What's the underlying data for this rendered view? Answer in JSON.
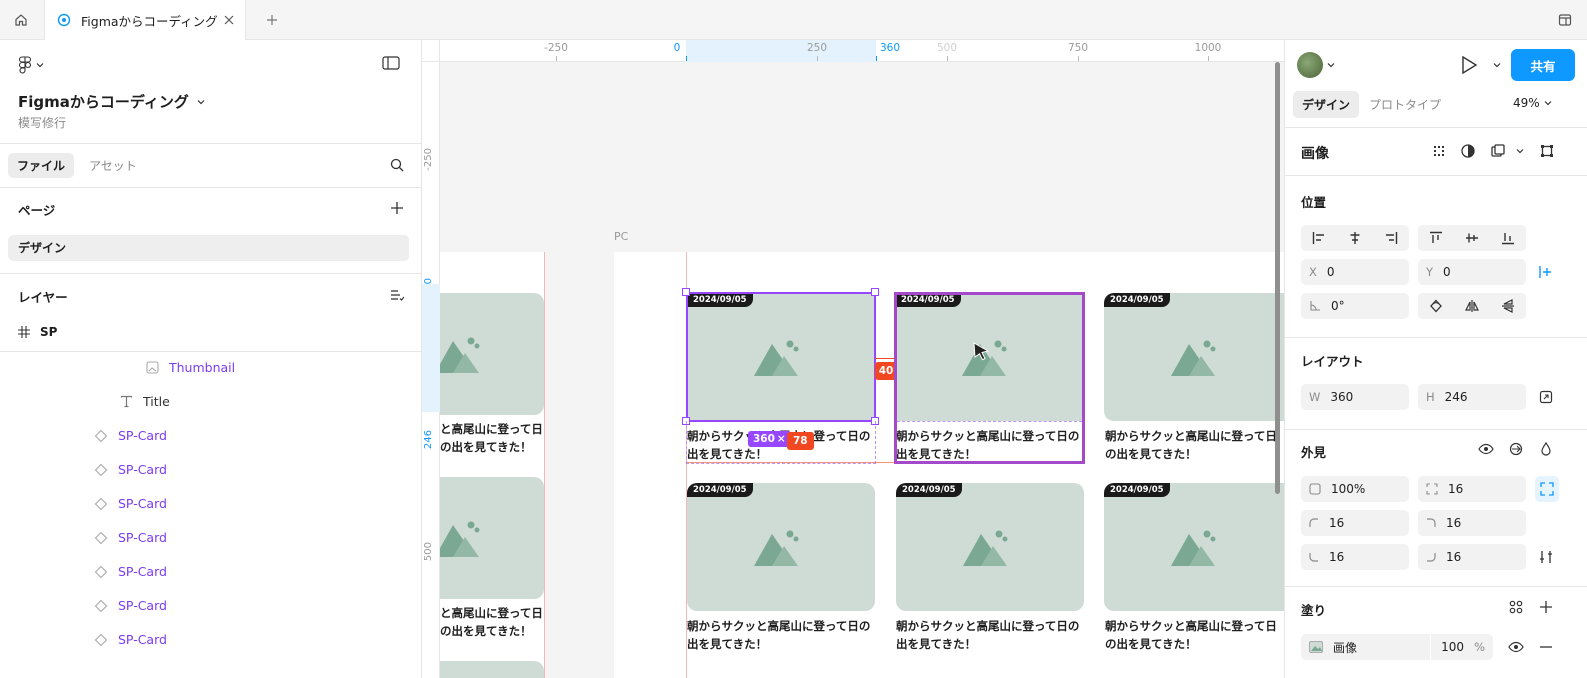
{
  "tabbar": {
    "tab_title": "Figmaからコーディング"
  },
  "left_panel": {
    "file_name": "Figmaからコーディング",
    "file_subtitle": "模写修行",
    "tabs": [
      "ファイル",
      "アセット"
    ],
    "pages_title": "ページ",
    "current_page": "デザイン",
    "layers_title": "レイヤー",
    "frame_name": "SP",
    "layers": [
      {
        "name": "Thumbnail",
        "icon": "image-icon"
      },
      {
        "name": "Title",
        "icon": "text-icon"
      },
      {
        "name": "SP-Card",
        "icon": "instance-icon"
      },
      {
        "name": "SP-Card",
        "icon": "instance-icon"
      },
      {
        "name": "SP-Card",
        "icon": "instance-icon"
      },
      {
        "name": "SP-Card",
        "icon": "instance-icon"
      },
      {
        "name": "SP-Card",
        "icon": "instance-icon"
      },
      {
        "name": "SP-Card",
        "icon": "instance-icon"
      },
      {
        "name": "SP-Card",
        "icon": "instance-icon"
      }
    ]
  },
  "canvas": {
    "ruler_top": [
      "-250",
      "0",
      "250",
      "360",
      "500",
      "750",
      "1000"
    ],
    "ruler_left": [
      "-250",
      "0",
      "246",
      "500"
    ],
    "frame_label": "PC",
    "card_date": "2024/09/05",
    "card_title": "朝からサクッと高尾山に登って日の出を見てきた！",
    "card_title_partial": "と高尾山に登って日の出を見てきた！",
    "size_badge_w": "360",
    "size_badge_sep": "×",
    "size_badge_h": "78",
    "gap_badge": "40"
  },
  "right_panel": {
    "share_label": "共有",
    "tabs": [
      "デザイン",
      "プロトタイプ"
    ],
    "zoom": "49%",
    "selection_title": "画像",
    "position_title": "位置",
    "x_label": "X",
    "x_value": "0",
    "y_label": "Y",
    "y_value": "0",
    "rotation": "0°",
    "layout_title": "レイアウト",
    "w_label": "W",
    "w_value": "360",
    "h_label": "H",
    "h_value": "246",
    "appearance_title": "外見",
    "opacity": "100%",
    "radius": "16",
    "radius_tl": "16",
    "radius_tr": "16",
    "radius_bl": "16",
    "radius_br": "16",
    "fill_title": "塗り",
    "fill_type": "画像",
    "fill_opacity": "100",
    "fill_pct": "%"
  },
  "colors": {
    "accent": "#0d99ff",
    "selection": "#9747ff",
    "measure": "#f24822",
    "card_bg": "#cfdcd5",
    "mountain": "#7aa892"
  }
}
